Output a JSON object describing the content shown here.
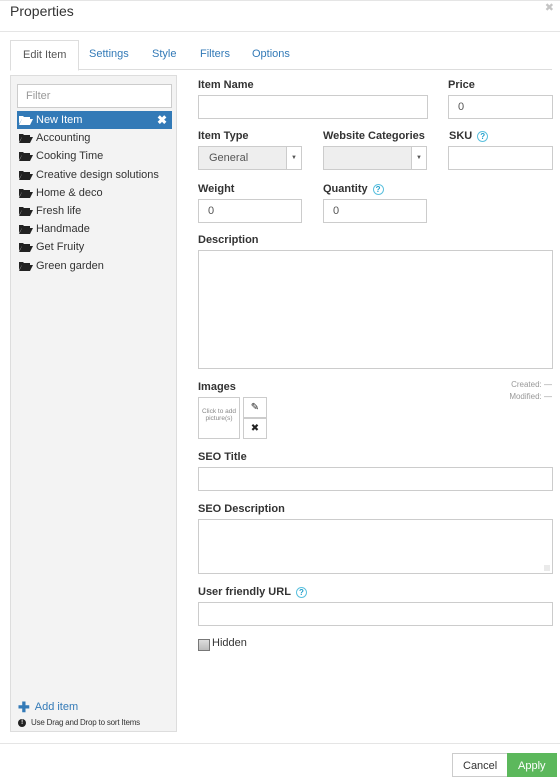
{
  "dialog": {
    "title": "Properties",
    "close_icon": "close-icon"
  },
  "tabs": [
    {
      "label": "Edit Item",
      "active": true
    },
    {
      "label": "Settings",
      "active": false
    },
    {
      "label": "Style",
      "active": false
    },
    {
      "label": "Filters",
      "active": false
    },
    {
      "label": "Options",
      "active": false
    }
  ],
  "sidebar": {
    "filter_placeholder": "Filter",
    "filter_value": "",
    "items": [
      {
        "label": "New Item",
        "selected": true,
        "icon": "folder-open-icon"
      },
      {
        "label": "Accounting",
        "icon": "folder-open-icon"
      },
      {
        "label": "Cooking Time",
        "icon": "folder-open-icon"
      },
      {
        "label": "Creative design solutions",
        "icon": "folder-open-icon"
      },
      {
        "label": "Home & deco",
        "icon": "folder-open-icon"
      },
      {
        "label": "Fresh life",
        "icon": "folder-open-icon"
      },
      {
        "label": "Handmade",
        "icon": "folder-open-icon"
      },
      {
        "label": "Get Fruity",
        "icon": "folder-open-icon"
      },
      {
        "label": "Green garden",
        "icon": "folder-open-icon"
      }
    ],
    "remove_icon": "✖",
    "add_item_label": "Add item",
    "hint": "Use Drag and Drop to sort Items"
  },
  "form": {
    "item_name": {
      "label": "Item Name",
      "value": ""
    },
    "price": {
      "label": "Price",
      "value": "0"
    },
    "item_type": {
      "label": "Item Type",
      "value": "General"
    },
    "website_categories": {
      "label": "Website Categories",
      "value": ""
    },
    "sku": {
      "label": "SKU",
      "value": "",
      "help": "?"
    },
    "weight": {
      "label": "Weight",
      "value": "0"
    },
    "quantity": {
      "label": "Quantity",
      "value": "0",
      "help": "?"
    },
    "description": {
      "label": "Description",
      "value": ""
    },
    "images": {
      "label": "Images",
      "placeholder": "Click to add picture(s)",
      "edit_icon": "✎",
      "remove_icon": "✖"
    },
    "created": "Created: —",
    "modified": "Modified: —",
    "seo_title": {
      "label": "SEO Title",
      "value": ""
    },
    "seo_description": {
      "label": "SEO Description",
      "value": ""
    },
    "url": {
      "label": "User friendly URL",
      "value": "",
      "help": "?"
    },
    "hidden": {
      "label": "Hidden",
      "checked": false
    }
  },
  "footer": {
    "cancel_label": "Cancel",
    "apply_label": "Apply"
  },
  "colors": {
    "accent": "#337ab7",
    "apply": "#5cb85c",
    "help": "#5bc0de"
  }
}
